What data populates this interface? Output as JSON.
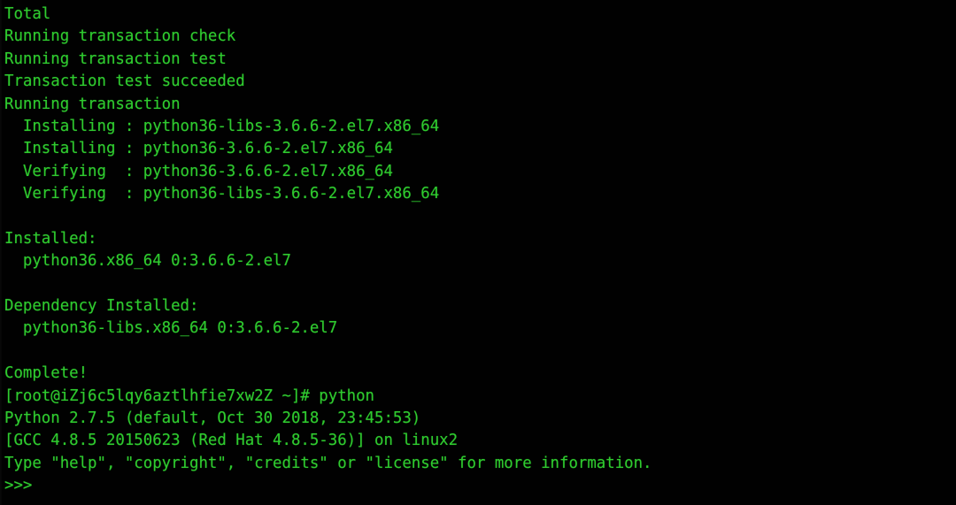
{
  "terminal": {
    "background_color": "#010101",
    "foreground_color": "#2fcb2f",
    "user": "root",
    "host": "iZj6c5lqy6aztlhfie7xw2Z",
    "cwd": "~",
    "prompt_symbol": "#",
    "python_prompt": ">>>",
    "lines": [
      "Total",
      "Running transaction check",
      "Running transaction test",
      "Transaction test succeeded",
      "Running transaction",
      "  Installing : python36-libs-3.6.6-2.el7.x86_64",
      "  Installing : python36-3.6.6-2.el7.x86_64",
      "  Verifying  : python36-3.6.6-2.el7.x86_64",
      "  Verifying  : python36-libs-3.6.6-2.el7.x86_64",
      "",
      "Installed:",
      "  python36.x86_64 0:3.6.6-2.el7",
      "",
      "Dependency Installed:",
      "  python36-libs.x86_64 0:3.6.6-2.el7",
      "",
      "Complete!",
      "[root@iZj6c5lqy6aztlhfie7xw2Z ~]# python",
      "Python 2.7.5 (default, Oct 30 2018, 23:45:53)",
      "[GCC 4.8.5 20150623 (Red Hat 4.8.5-36)] on linux2",
      "Type \"help\", \"copyright\", \"credits\" or \"license\" for more information.",
      ">>>"
    ]
  }
}
